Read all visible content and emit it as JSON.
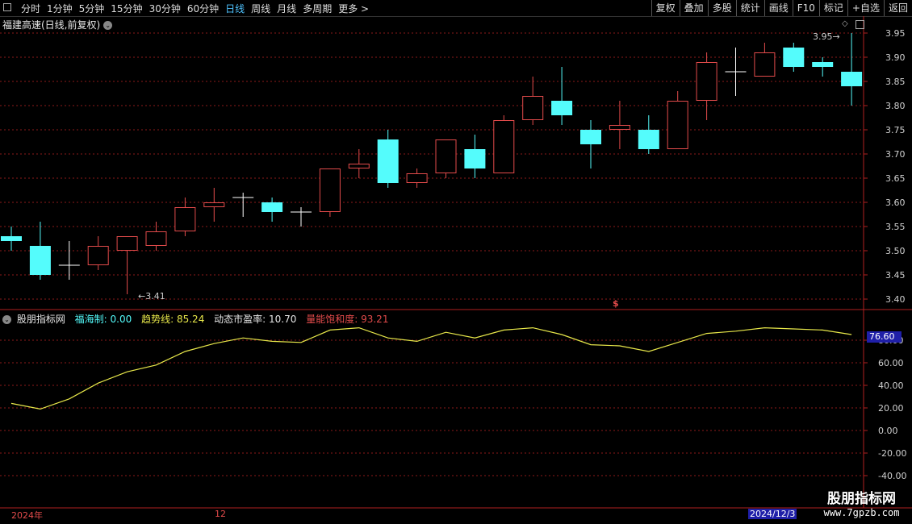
{
  "toolbar": {
    "periods": [
      "分时",
      "1分钟",
      "5分钟",
      "15分钟",
      "30分钟",
      "60分钟",
      "日线",
      "周线",
      "月线",
      "多周期",
      "更多 >"
    ],
    "active_period": "日线",
    "tools": [
      "复权",
      "叠加",
      "多股",
      "统计",
      "画线",
      "F10",
      "标记",
      "+自选",
      "返回"
    ]
  },
  "title": "福建高速(日线,前复权)",
  "indicator": {
    "name": "股朋指标网",
    "fuhai_label": "福海制:",
    "fuhai_value": "0.00",
    "trend_label": "趋势线:",
    "trend_value": "85.24",
    "pe_label": "动态市盈率:",
    "pe_value": "10.70",
    "vol_label": "量能饱和度:",
    "vol_value": "93.21",
    "current_box": "76.60"
  },
  "colors": {
    "up": "#e34b4b",
    "down": "#54fcfc",
    "doji": "#ffffff",
    "trend": "#e8e84a",
    "grid": "#8b1a1a",
    "axis": "#b02020"
  },
  "labels": {
    "high_marker": "3.95",
    "low_marker": "3.41",
    "date_left": "2024年",
    "date_mid": "12",
    "date_box": "2024/12/3",
    "watermark_big": "股朋指标网",
    "watermark_small": "www.7gpzb.com",
    "dollar": "$"
  },
  "chart_data": [
    {
      "type": "candlestick",
      "ylim": [
        3.37,
        3.98
      ],
      "yticks": [
        "3.95",
        "3.90",
        "3.85",
        "3.80",
        "3.75",
        "3.70",
        "3.65",
        "3.60",
        "3.55",
        "3.50",
        "3.45",
        "3.40"
      ],
      "candles": [
        {
          "o": 3.53,
          "h": 3.55,
          "l": 3.5,
          "c": 3.52
        },
        {
          "o": 3.51,
          "h": 3.56,
          "l": 3.44,
          "c": 3.45
        },
        {
          "o": 3.47,
          "h": 3.52,
          "l": 3.44,
          "c": 3.47
        },
        {
          "o": 3.47,
          "h": 3.53,
          "l": 3.46,
          "c": 3.51
        },
        {
          "o": 3.5,
          "h": 3.53,
          "l": 3.41,
          "c": 3.53
        },
        {
          "o": 3.51,
          "h": 3.56,
          "l": 3.5,
          "c": 3.54
        },
        {
          "o": 3.54,
          "h": 3.61,
          "l": 3.53,
          "c": 3.59
        },
        {
          "o": 3.59,
          "h": 3.63,
          "l": 3.56,
          "c": 3.6
        },
        {
          "o": 3.61,
          "h": 3.62,
          "l": 3.57,
          "c": 3.61
        },
        {
          "o": 3.6,
          "h": 3.61,
          "l": 3.56,
          "c": 3.58
        },
        {
          "o": 3.58,
          "h": 3.59,
          "l": 3.55,
          "c": 3.58
        },
        {
          "o": 3.58,
          "h": 3.67,
          "l": 3.57,
          "c": 3.67
        },
        {
          "o": 3.67,
          "h": 3.71,
          "l": 3.65,
          "c": 3.68
        },
        {
          "o": 3.73,
          "h": 3.75,
          "l": 3.63,
          "c": 3.64
        },
        {
          "o": 3.64,
          "h": 3.67,
          "l": 3.63,
          "c": 3.66
        },
        {
          "o": 3.66,
          "h": 3.73,
          "l": 3.65,
          "c": 3.73
        },
        {
          "o": 3.71,
          "h": 3.74,
          "l": 3.65,
          "c": 3.67
        },
        {
          "o": 3.66,
          "h": 3.78,
          "l": 3.66,
          "c": 3.77
        },
        {
          "o": 3.77,
          "h": 3.86,
          "l": 3.76,
          "c": 3.82
        },
        {
          "o": 3.81,
          "h": 3.88,
          "l": 3.76,
          "c": 3.78
        },
        {
          "o": 3.75,
          "h": 3.77,
          "l": 3.67,
          "c": 3.72
        },
        {
          "o": 3.75,
          "h": 3.81,
          "l": 3.71,
          "c": 3.76
        },
        {
          "o": 3.75,
          "h": 3.78,
          "l": 3.7,
          "c": 3.71
        },
        {
          "o": 3.71,
          "h": 3.83,
          "l": 3.71,
          "c": 3.81
        },
        {
          "o": 3.81,
          "h": 3.91,
          "l": 3.77,
          "c": 3.89
        },
        {
          "o": 3.87,
          "h": 3.92,
          "l": 3.82,
          "c": 3.87
        },
        {
          "o": 3.86,
          "h": 3.93,
          "l": 3.86,
          "c": 3.91
        },
        {
          "o": 3.92,
          "h": 3.93,
          "l": 3.87,
          "c": 3.88
        },
        {
          "o": 3.89,
          "h": 3.9,
          "l": 3.86,
          "c": 3.88
        },
        {
          "o": 3.87,
          "h": 3.95,
          "l": 3.8,
          "c": 3.84
        }
      ]
    },
    {
      "type": "line",
      "ylim": [
        -48,
        95
      ],
      "yticks": [
        "80.00",
        "60.00",
        "40.00",
        "20.00",
        "0.00",
        "-20.00",
        "-40.00"
      ],
      "series": [
        {
          "values": [
            24,
            19,
            28,
            42,
            52,
            58,
            70,
            77,
            82,
            79,
            78,
            89,
            91,
            82,
            79,
            87,
            82,
            89,
            91,
            85,
            76,
            75,
            70,
            78,
            86,
            88,
            91,
            90,
            89,
            85
          ]
        }
      ]
    }
  ]
}
